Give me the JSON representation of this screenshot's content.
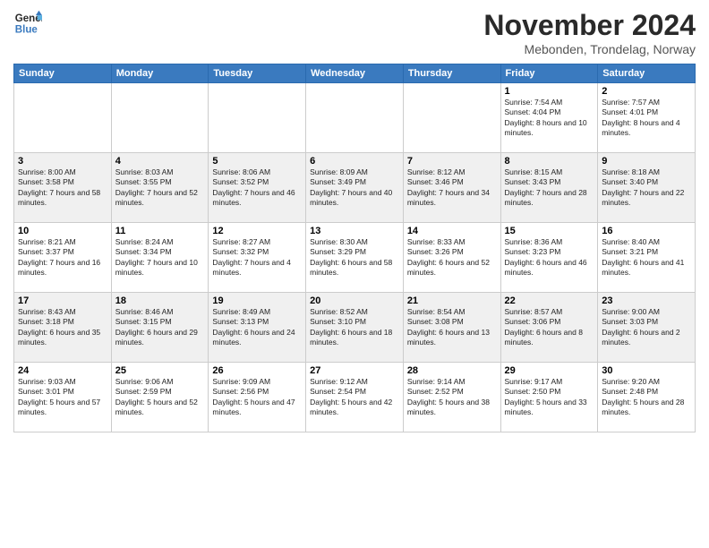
{
  "logo": {
    "line1": "General",
    "line2": "Blue"
  },
  "title": "November 2024",
  "location": "Mebonden, Trondelag, Norway",
  "days_of_week": [
    "Sunday",
    "Monday",
    "Tuesday",
    "Wednesday",
    "Thursday",
    "Friday",
    "Saturday"
  ],
  "weeks": [
    [
      {
        "day": "",
        "info": ""
      },
      {
        "day": "",
        "info": ""
      },
      {
        "day": "",
        "info": ""
      },
      {
        "day": "",
        "info": ""
      },
      {
        "day": "",
        "info": ""
      },
      {
        "day": "1",
        "info": "Sunrise: 7:54 AM\nSunset: 4:04 PM\nDaylight: 8 hours and 10 minutes."
      },
      {
        "day": "2",
        "info": "Sunrise: 7:57 AM\nSunset: 4:01 PM\nDaylight: 8 hours and 4 minutes."
      }
    ],
    [
      {
        "day": "3",
        "info": "Sunrise: 8:00 AM\nSunset: 3:58 PM\nDaylight: 7 hours and 58 minutes."
      },
      {
        "day": "4",
        "info": "Sunrise: 8:03 AM\nSunset: 3:55 PM\nDaylight: 7 hours and 52 minutes."
      },
      {
        "day": "5",
        "info": "Sunrise: 8:06 AM\nSunset: 3:52 PM\nDaylight: 7 hours and 46 minutes."
      },
      {
        "day": "6",
        "info": "Sunrise: 8:09 AM\nSunset: 3:49 PM\nDaylight: 7 hours and 40 minutes."
      },
      {
        "day": "7",
        "info": "Sunrise: 8:12 AM\nSunset: 3:46 PM\nDaylight: 7 hours and 34 minutes."
      },
      {
        "day": "8",
        "info": "Sunrise: 8:15 AM\nSunset: 3:43 PM\nDaylight: 7 hours and 28 minutes."
      },
      {
        "day": "9",
        "info": "Sunrise: 8:18 AM\nSunset: 3:40 PM\nDaylight: 7 hours and 22 minutes."
      }
    ],
    [
      {
        "day": "10",
        "info": "Sunrise: 8:21 AM\nSunset: 3:37 PM\nDaylight: 7 hours and 16 minutes."
      },
      {
        "day": "11",
        "info": "Sunrise: 8:24 AM\nSunset: 3:34 PM\nDaylight: 7 hours and 10 minutes."
      },
      {
        "day": "12",
        "info": "Sunrise: 8:27 AM\nSunset: 3:32 PM\nDaylight: 7 hours and 4 minutes."
      },
      {
        "day": "13",
        "info": "Sunrise: 8:30 AM\nSunset: 3:29 PM\nDaylight: 6 hours and 58 minutes."
      },
      {
        "day": "14",
        "info": "Sunrise: 8:33 AM\nSunset: 3:26 PM\nDaylight: 6 hours and 52 minutes."
      },
      {
        "day": "15",
        "info": "Sunrise: 8:36 AM\nSunset: 3:23 PM\nDaylight: 6 hours and 46 minutes."
      },
      {
        "day": "16",
        "info": "Sunrise: 8:40 AM\nSunset: 3:21 PM\nDaylight: 6 hours and 41 minutes."
      }
    ],
    [
      {
        "day": "17",
        "info": "Sunrise: 8:43 AM\nSunset: 3:18 PM\nDaylight: 6 hours and 35 minutes."
      },
      {
        "day": "18",
        "info": "Sunrise: 8:46 AM\nSunset: 3:15 PM\nDaylight: 6 hours and 29 minutes."
      },
      {
        "day": "19",
        "info": "Sunrise: 8:49 AM\nSunset: 3:13 PM\nDaylight: 6 hours and 24 minutes."
      },
      {
        "day": "20",
        "info": "Sunrise: 8:52 AM\nSunset: 3:10 PM\nDaylight: 6 hours and 18 minutes."
      },
      {
        "day": "21",
        "info": "Sunrise: 8:54 AM\nSunset: 3:08 PM\nDaylight: 6 hours and 13 minutes."
      },
      {
        "day": "22",
        "info": "Sunrise: 8:57 AM\nSunset: 3:06 PM\nDaylight: 6 hours and 8 minutes."
      },
      {
        "day": "23",
        "info": "Sunrise: 9:00 AM\nSunset: 3:03 PM\nDaylight: 6 hours and 2 minutes."
      }
    ],
    [
      {
        "day": "24",
        "info": "Sunrise: 9:03 AM\nSunset: 3:01 PM\nDaylight: 5 hours and 57 minutes."
      },
      {
        "day": "25",
        "info": "Sunrise: 9:06 AM\nSunset: 2:59 PM\nDaylight: 5 hours and 52 minutes."
      },
      {
        "day": "26",
        "info": "Sunrise: 9:09 AM\nSunset: 2:56 PM\nDaylight: 5 hours and 47 minutes."
      },
      {
        "day": "27",
        "info": "Sunrise: 9:12 AM\nSunset: 2:54 PM\nDaylight: 5 hours and 42 minutes."
      },
      {
        "day": "28",
        "info": "Sunrise: 9:14 AM\nSunset: 2:52 PM\nDaylight: 5 hours and 38 minutes."
      },
      {
        "day": "29",
        "info": "Sunrise: 9:17 AM\nSunset: 2:50 PM\nDaylight: 5 hours and 33 minutes."
      },
      {
        "day": "30",
        "info": "Sunrise: 9:20 AM\nSunset: 2:48 PM\nDaylight: 5 hours and 28 minutes."
      }
    ]
  ]
}
